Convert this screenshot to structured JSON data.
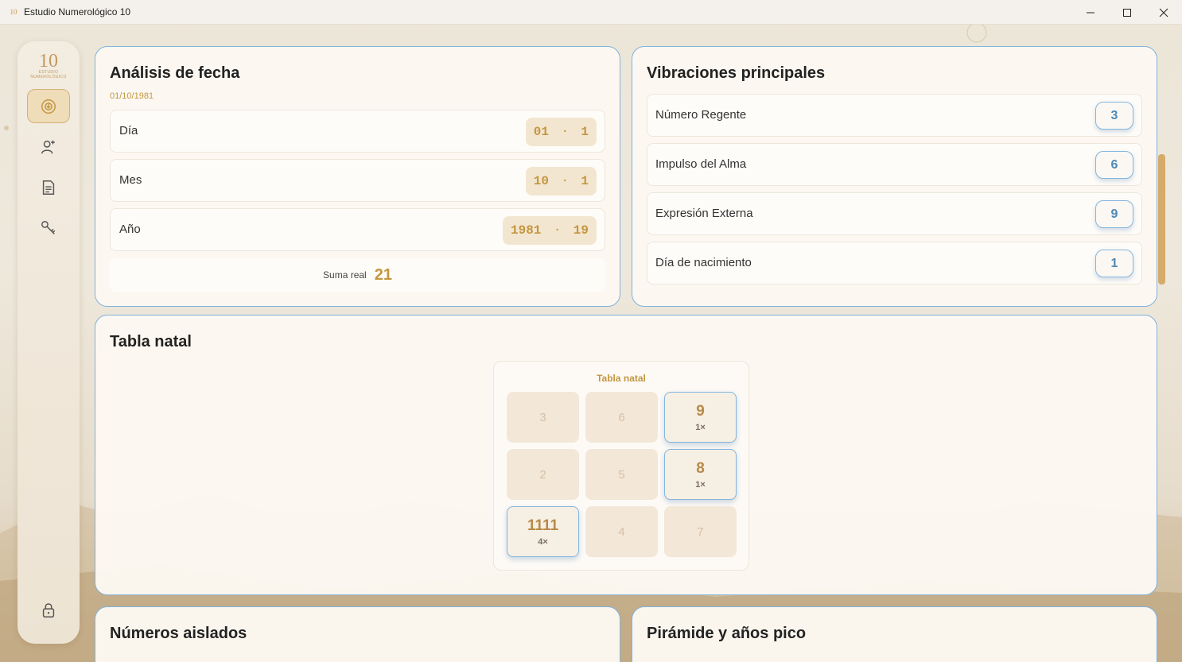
{
  "window": {
    "title": "Estudio Numerológico 10",
    "icon_text": "10",
    "minimize_glyph": "—",
    "maximize_glyph": "☐",
    "close_glyph": "✕"
  },
  "sidebar": {
    "logo_number": "10",
    "logo_caption_1": "ESTUDIO",
    "logo_caption_2": "NUMEROLÓGICO",
    "items": [
      {
        "icon": "numerology-icon",
        "active": true
      },
      {
        "icon": "person-add-icon",
        "active": false
      },
      {
        "icon": "document-icon",
        "active": false
      },
      {
        "icon": "key-icon",
        "active": false
      }
    ],
    "bottom_icon": "lock-icon"
  },
  "date_analysis": {
    "title": "Análisis de fecha",
    "date": "01/10/1981",
    "rows": [
      {
        "label": "Día",
        "value": "01",
        "reduced": "1"
      },
      {
        "label": "Mes",
        "value": "10",
        "reduced": "1"
      },
      {
        "label": "Año",
        "value": "1981",
        "reduced": "19"
      }
    ],
    "separator": "·",
    "sum_label": "Suma real",
    "sum_value": "21"
  },
  "vibrations": {
    "title": "Vibraciones principales",
    "items": [
      {
        "label": "Número Regente",
        "value": "3"
      },
      {
        "label": "Impulso del Alma",
        "value": "6"
      },
      {
        "label": "Expresión Externa",
        "value": "9"
      },
      {
        "label": "Día de nacimiento",
        "value": "1"
      }
    ]
  },
  "natal_table": {
    "title": "Tabla natal",
    "inner_title": "Tabla natal",
    "cells": [
      {
        "number": "3",
        "count": ""
      },
      {
        "number": "6",
        "count": ""
      },
      {
        "number": "9",
        "count": "1×"
      },
      {
        "number": "2",
        "count": ""
      },
      {
        "number": "5",
        "count": ""
      },
      {
        "number": "8",
        "count": "1×"
      },
      {
        "number": "1111",
        "count": "4×"
      },
      {
        "number": "4",
        "count": ""
      },
      {
        "number": "7",
        "count": ""
      }
    ]
  },
  "isolated_numbers": {
    "title": "Números aislados"
  },
  "pyramid": {
    "title": "Pirámide y años pico"
  },
  "colors": {
    "accent_gold": "#c4963f",
    "accent_blue": "#84b6de",
    "card_bg": "#fcf8f2",
    "scroll_thumb": "#d5ab6a"
  }
}
